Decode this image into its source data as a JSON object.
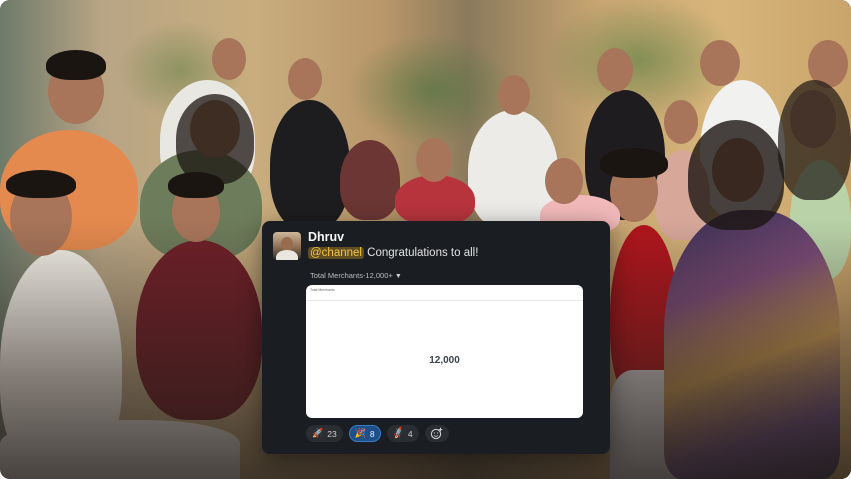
{
  "message": {
    "sender": "Dhruv",
    "mention": "@channel",
    "text": "Congratulations to all!",
    "attachment": {
      "title": "Total Merchants-12,000+",
      "caret_icon": "caret-down-icon",
      "preview_header": "Total Merchants",
      "preview_subtext": "",
      "metric": "12,000"
    },
    "reactions": [
      {
        "icon": "rocket-icon",
        "emoji": "🚀",
        "count": "23",
        "active": false
      },
      {
        "icon": "party-popper-icon",
        "emoji": "🎉",
        "count": "8",
        "active": true
      },
      {
        "icon": "flying-rocket-icon",
        "emoji": "🚀",
        "count": "4",
        "active": false
      }
    ],
    "add_reaction_icon": "add-emoji-icon"
  },
  "colors": {
    "card_bg": "#1a1d21",
    "mention_bg": "#e8ab29",
    "active_reaction": "#1f4f87"
  }
}
